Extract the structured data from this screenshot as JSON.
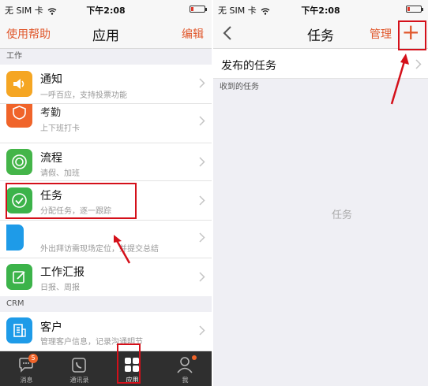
{
  "left": {
    "status": {
      "carrier": "无 SIM 卡",
      "time": "下午2:08",
      "battery_level": 0.15
    },
    "nav": {
      "left": "使用帮助",
      "title": "应用",
      "right": "编辑"
    },
    "sections": [
      {
        "header": "工作"
      },
      {
        "header": "CRM"
      }
    ],
    "apps": [
      {
        "name": "通知",
        "desc": "一呼百应，支持投票功能",
        "icon": "speaker-icon",
        "color": "#f5a623"
      },
      {
        "name": "考勤",
        "desc": "上下班打卡",
        "icon": "shield-check-icon",
        "color": "#f0642a"
      },
      {
        "name": "流程",
        "desc": "请假、加班",
        "icon": "target-icon",
        "color": "#44b549"
      },
      {
        "name": "任务",
        "desc": "分配任务，逐一跟踪",
        "icon": "check-circle-icon",
        "color": "#3cb34a"
      },
      {
        "name": "",
        "desc": "外出拜访需现场定位，并提交总结",
        "icon": "location-icon",
        "color": "#1e9be8"
      },
      {
        "name": "工作汇报",
        "desc": "日报、周报",
        "icon": "edit-icon",
        "color": "#3cb34a"
      },
      {
        "name": "客户",
        "desc": "管理客户信息，记录沟通明节",
        "icon": "building-icon",
        "color": "#1e9be8"
      }
    ],
    "tabs": [
      {
        "label": "消息",
        "icon": "chat-icon",
        "badge": "5"
      },
      {
        "label": "通讯录",
        "icon": "phone-icon"
      },
      {
        "label": "应用",
        "icon": "apps-grid-icon"
      },
      {
        "label": "我",
        "icon": "person-icon"
      }
    ]
  },
  "right": {
    "status": {
      "carrier": "无 SIM 卡",
      "time": "下午2:08",
      "battery_level": 0.15
    },
    "nav": {
      "title": "任务",
      "manage": "管理",
      "add": "+"
    },
    "published": "发布的任务",
    "received_header": "收到的任务",
    "empty_text": "任务"
  },
  "colors": {
    "accent": "#e0572b",
    "highlight": "#d4101a"
  }
}
